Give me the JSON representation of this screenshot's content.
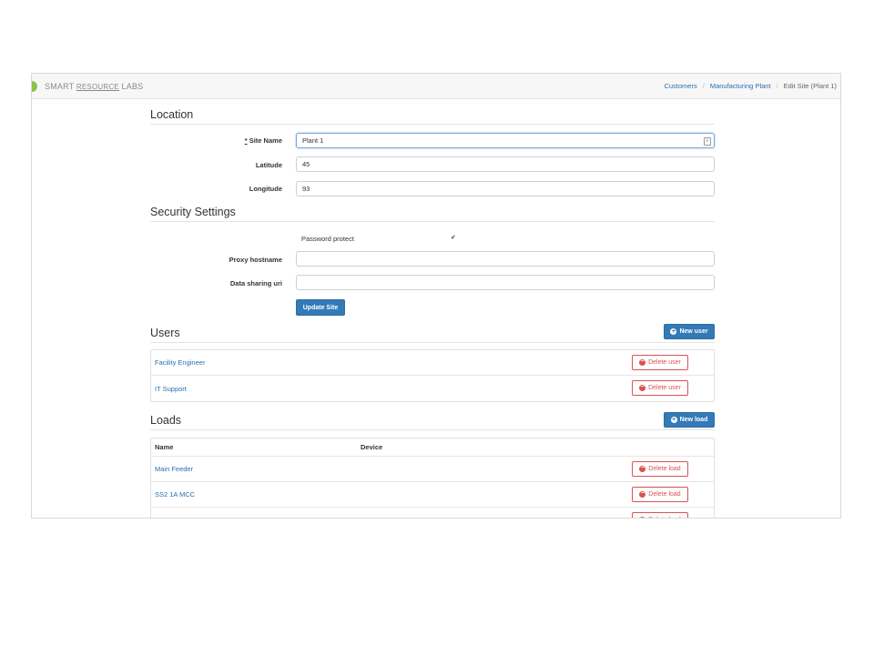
{
  "brand": {
    "left": "SMART",
    "mid": "RESOURCE",
    "right": "LABS"
  },
  "breadcrumb": [
    {
      "label": "Customers",
      "link": true
    },
    {
      "label": "Manufacturing Plant",
      "link": true
    },
    {
      "label": "Edit Site (Plant 1)",
      "link": false
    }
  ],
  "breadcrumb_sep": "/",
  "location": {
    "title": "Location",
    "site_name_req": "*",
    "site_name_label": "Site Name",
    "site_name_value": "Plant 1",
    "latitude_label": "Latitude",
    "latitude_value": "45",
    "longitude_label": "Longitude",
    "longitude_value": "93"
  },
  "security": {
    "title": "Security Settings",
    "password_protect_label": "Password protect",
    "password_protect_checked": true,
    "checkbox_glyph": "✔",
    "proxy_label": "Proxy hostname",
    "proxy_value": "",
    "sharing_label": "Data sharing uri",
    "sharing_value": "",
    "update_button": "Update Site"
  },
  "users": {
    "title": "Users",
    "new_button": "New user",
    "delete_label": "Delete user",
    "items": [
      {
        "name": "Facility Engineer"
      },
      {
        "name": "IT Support"
      }
    ]
  },
  "loads": {
    "title": "Loads",
    "new_button": "New load",
    "delete_label": "Delete load",
    "columns": {
      "name": "Name",
      "device": "Device"
    },
    "items": [
      {
        "name": "Main Feeder",
        "device": ""
      },
      {
        "name": "SS2 1A MCC",
        "device": ""
      },
      {
        "name": "",
        "device": ""
      }
    ]
  },
  "icons": {
    "plus": "+",
    "minus": "−"
  },
  "colors": {
    "primary": "#337ab7",
    "danger": "#d9534f",
    "link": "#2a6fb0"
  }
}
